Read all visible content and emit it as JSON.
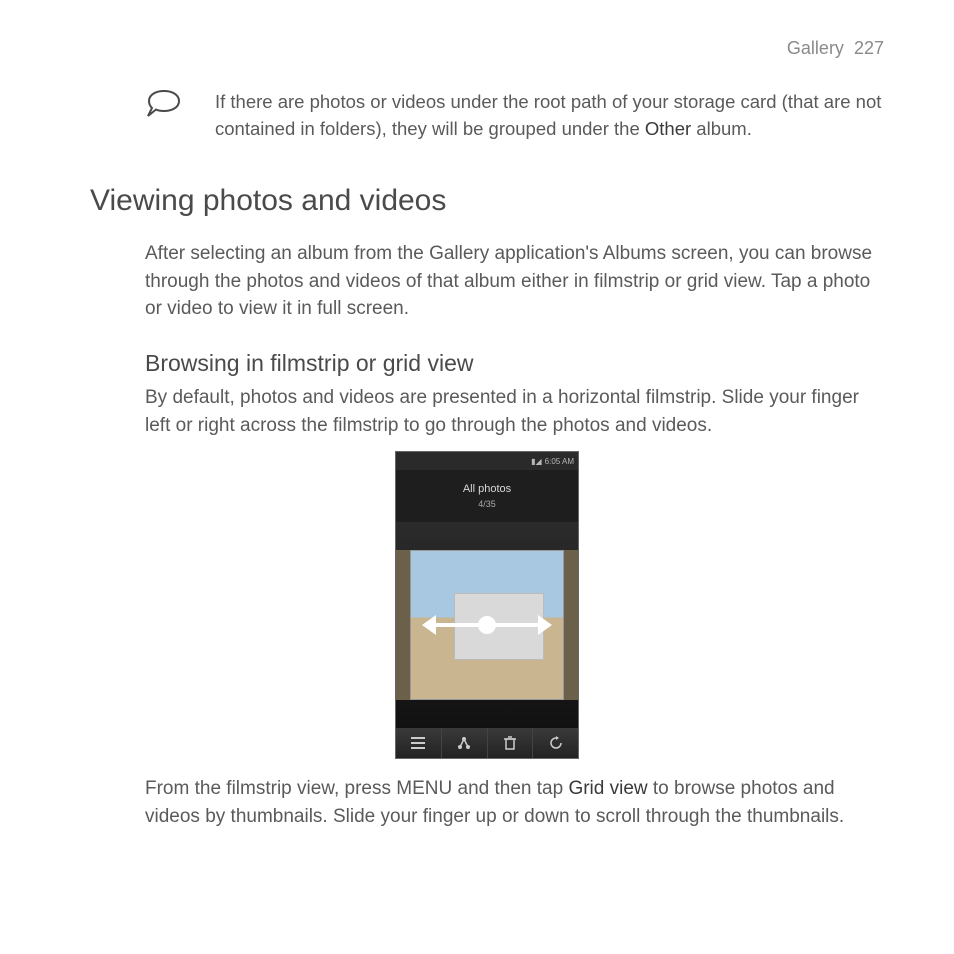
{
  "header": {
    "section": "Gallery",
    "page": "227"
  },
  "tip": {
    "text_before": "If there are photos or videos under the root path of your storage card (that are not contained in folders), they will be grouped under the ",
    "bold": "Other",
    "text_after": " album."
  },
  "section_title": "Viewing photos and videos",
  "intro": "After selecting an album from the Gallery application's Albums screen, you can browse through the photos and videos of that album either in filmstrip or grid view. Tap a photo or video to view it in full screen.",
  "subsection_title": "Browsing in filmstrip or grid view",
  "subsection_text": "By default, photos and videos are presented in a horizontal filmstrip. Slide your finger left or right across the filmstrip to go through the photos and videos.",
  "phone": {
    "status_time": "6:05 AM",
    "album_title": "All photos",
    "album_count": "4/35",
    "toolbar_icons": [
      "menu-icon",
      "share-icon",
      "trash-icon",
      "rotate-icon"
    ]
  },
  "after_image": {
    "p1_before": "From the filmstrip view, press MENU and then tap ",
    "p1_bold": "Grid view",
    "p1_after": " to browse photos and videos by thumbnails. Slide your finger up or down to scroll through the thumbnails."
  }
}
